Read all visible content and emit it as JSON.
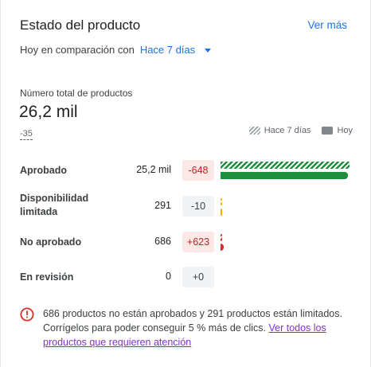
{
  "header": {
    "title": "Estado del producto",
    "see_more": "Ver más"
  },
  "comparison": {
    "label": "Hoy en comparación con",
    "selected": "Hace 7 días"
  },
  "total": {
    "label": "Número total de productos",
    "value": "26,2 mil",
    "delta": "-35"
  },
  "legend": {
    "previous": "Hace 7 días",
    "current": "Hoy"
  },
  "rows": [
    {
      "label": "Aprobado",
      "count": "25,2 mil",
      "delta": "-648",
      "prev_fraction": 1.0,
      "now_fraction": 0.985,
      "bar_color": "#1e8e3e"
    },
    {
      "label": "Disponibilidad limitada",
      "count": "291",
      "delta": "-10",
      "prev_fraction": 0.012,
      "now_fraction": 0.011,
      "bar_color": "#f9ab00"
    },
    {
      "label": "No aprobado",
      "count": "686",
      "delta": "+623",
      "prev_fraction": 0.003,
      "now_fraction": 0.027,
      "bar_color": "#d93025"
    },
    {
      "label": "En revisión",
      "count": "0",
      "delta": "+0",
      "prev_fraction": 0,
      "now_fraction": 0,
      "bar_color": "#9aa0a6"
    }
  ],
  "alert": {
    "message": "686 productos no están aprobados y 291 productos están limitados. Corrígelos para poder conseguir 5 % más de clics.",
    "link": "Ver todos los productos que requieren atención",
    "color": "#d93025"
  }
}
